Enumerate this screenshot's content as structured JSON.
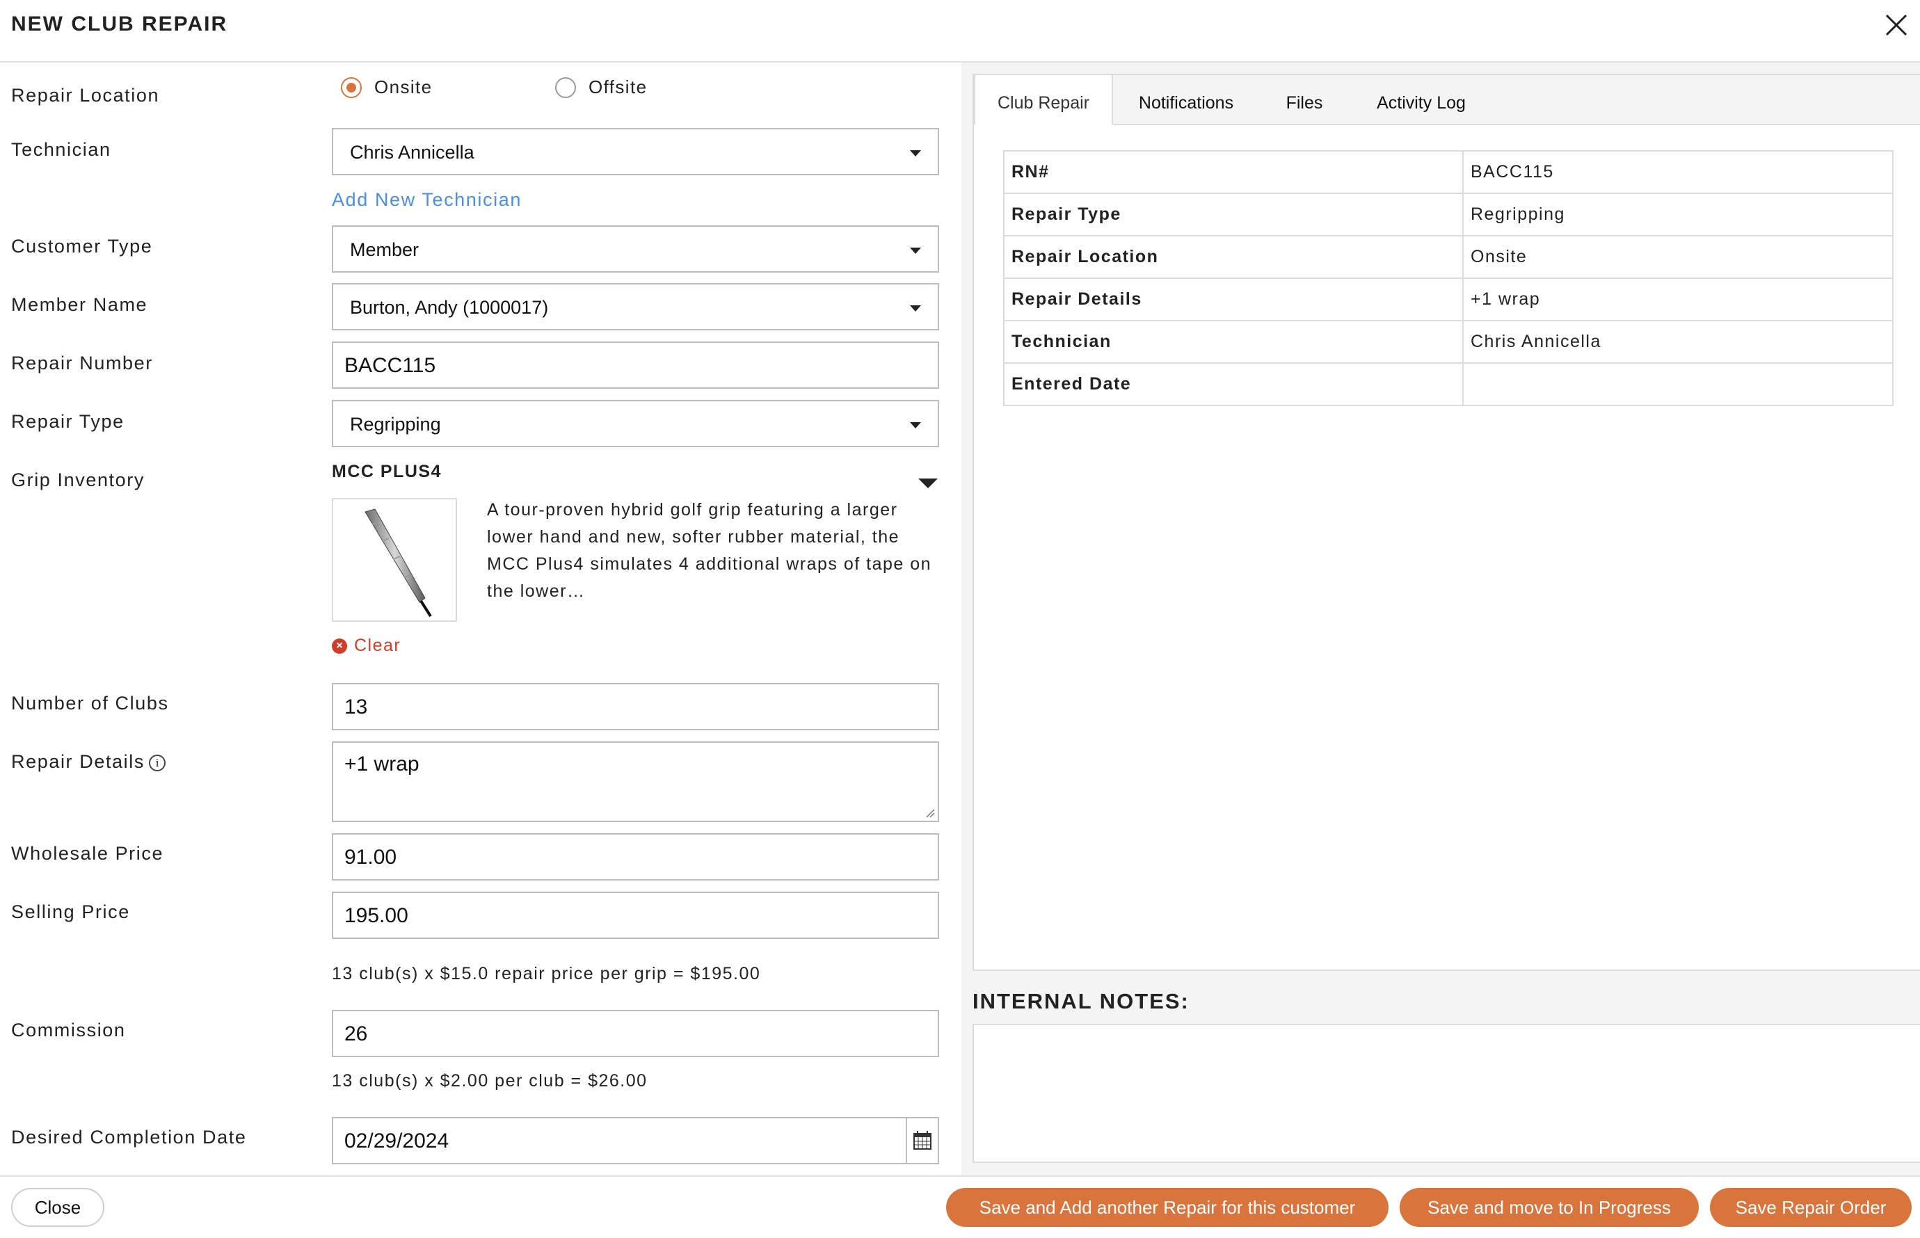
{
  "header": {
    "title": "NEW CLUB REPAIR"
  },
  "form": {
    "repair_location": {
      "label": "Repair Location",
      "options": [
        "Onsite",
        "Offsite"
      ],
      "selected": "Onsite"
    },
    "technician": {
      "label": "Technician",
      "value": "Chris Annicella",
      "add_link": "Add New Technician"
    },
    "customer_type": {
      "label": "Customer Type",
      "value": "Member"
    },
    "member_name": {
      "label": "Member Name",
      "value": "Burton, Andy (1000017)"
    },
    "repair_number": {
      "label": "Repair Number",
      "value": "BACC115"
    },
    "repair_type": {
      "label": "Repair Type",
      "value": "Regripping"
    },
    "grip_inventory": {
      "label": "Grip Inventory",
      "name": "MCC PLUS4",
      "description": "A tour-proven hybrid golf grip featuring a larger lower hand and new, softer rubber material, the MCC Plus4 simulates 4 additional wraps of tape on the lower…",
      "clear_label": "Clear"
    },
    "number_of_clubs": {
      "label": "Number of Clubs",
      "value": "13"
    },
    "repair_details": {
      "label": "Repair Details",
      "value": "+1 wrap"
    },
    "wholesale_price": {
      "label": "Wholesale Price",
      "value": "91.00"
    },
    "selling_price": {
      "label": "Selling Price",
      "value": "195.00",
      "hint": "13 club(s) x $15.0 repair price per grip = $195.00"
    },
    "commission": {
      "label": "Commission",
      "value": "26",
      "hint": "13 club(s) x $2.00 per club = $26.00"
    },
    "desired_completion_date": {
      "label": "Desired Completion Date",
      "value": "02/29/2024"
    }
  },
  "right_panel": {
    "tabs": [
      "Club Repair",
      "Notifications",
      "Files",
      "Activity Log"
    ],
    "active_tab": "Club Repair",
    "summary": [
      {
        "key": "RN#",
        "value": "BACC115"
      },
      {
        "key": "Repair Type",
        "value": "Regripping"
      },
      {
        "key": "Repair Location",
        "value": "Onsite"
      },
      {
        "key": "Repair Details",
        "value": "+1 wrap"
      },
      {
        "key": "Technician",
        "value": "Chris Annicella"
      },
      {
        "key": "Entered Date",
        "value": ""
      }
    ],
    "notes_title": "INTERNAL NOTES:"
  },
  "footer": {
    "close": "Close",
    "save_add_another": "Save and Add another Repair for this customer",
    "save_in_progress": "Save and move to In Progress",
    "save_order": "Save Repair Order"
  },
  "colors": {
    "accent": "#d9743d",
    "link": "#4a90e2",
    "danger": "#d23c2a",
    "border": "#bdbdbd"
  }
}
